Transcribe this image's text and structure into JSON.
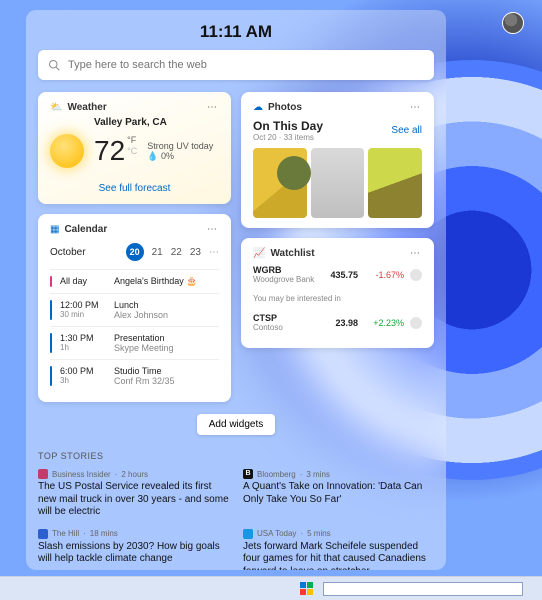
{
  "clock": "11:11 AM",
  "search": {
    "placeholder": "Type here to search the web"
  },
  "weather": {
    "card_title": "Weather",
    "location": "Valley Park, CA",
    "temp": "72",
    "unit_main": "°F",
    "unit_alt": "°C",
    "uv": "Strong UV today",
    "precip": "0%",
    "forecast_link": "See full forecast"
  },
  "calendar": {
    "card_title": "Calendar",
    "month": "October",
    "days": {
      "today": "20",
      "d1": "21",
      "d2": "22",
      "d3": "23"
    },
    "allday_label": "All day",
    "items": [
      {
        "time": "",
        "duration": "All day",
        "title": "Angela's Birthday 🎂",
        "sub": "",
        "color": "#d83b7d"
      },
      {
        "time": "12:00 PM",
        "duration": "30 min",
        "title": "Lunch",
        "sub": "Alex Johnson",
        "color": "#0067c5"
      },
      {
        "time": "1:30 PM",
        "duration": "1h",
        "title": "Presentation",
        "sub": "Skype Meeting",
        "color": "#0067c5"
      },
      {
        "time": "6:00 PM",
        "duration": "3h",
        "title": "Studio Time",
        "sub": "Conf Rm 32/35",
        "color": "#0067c5"
      }
    ]
  },
  "photos": {
    "card_title": "Photos",
    "heading": "On This Day",
    "meta": "Oct 20 · 33 items",
    "see_all": "See all"
  },
  "watchlist": {
    "card_title": "Watchlist",
    "rows": [
      {
        "symbol": "WGRB",
        "company": "Woodgrove Bank",
        "price": "435.75",
        "change": "-1.67%",
        "dir": "neg"
      }
    ],
    "suggest_label": "You may be interested in",
    "suggest": [
      {
        "symbol": "CTSP",
        "company": "Contoso",
        "price": "23.98",
        "change": "+2.23%",
        "dir": "pos"
      }
    ]
  },
  "add_widgets_label": "Add widgets",
  "top_stories": {
    "label": "TOP STORIES",
    "stories": [
      {
        "source": "Business Insider",
        "age": "2 hours",
        "icon_color": "#c33b6b",
        "headline": "The US Postal Service revealed its first new mail truck in over 30 years - and some will be electric"
      },
      {
        "source": "Bloomberg",
        "age": "3 mins",
        "icon_text": "B",
        "icon_color": "#111",
        "headline": "A Quant's Take on Innovation: 'Data Can Only Take You So Far'"
      },
      {
        "source": "The Hill",
        "age": "18 mins",
        "icon_color": "#2c5fcf",
        "headline": "Slash emissions by 2030? How big goals will help tackle climate change"
      },
      {
        "source": "USA Today",
        "age": "5 mins",
        "icon_color": "#1597e5",
        "headline": "Jets forward Mark Scheifele suspended four games for hit that caused Canadiens forward to leave on stretcher"
      }
    ]
  }
}
